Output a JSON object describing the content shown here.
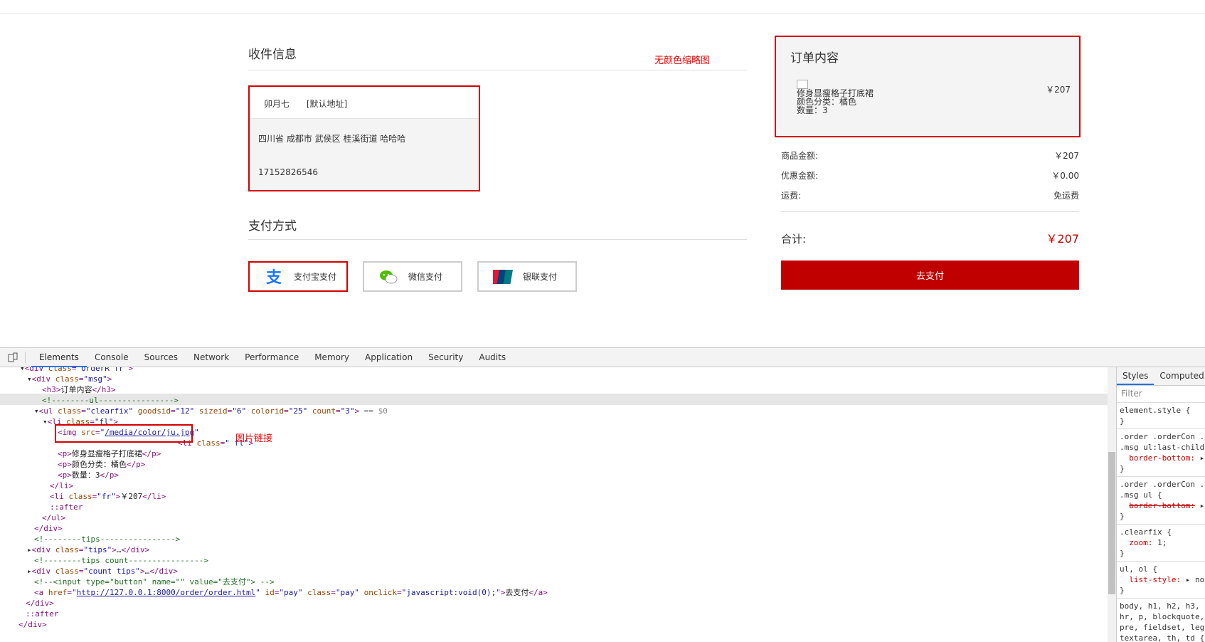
{
  "page": {
    "address_title": "收件信息",
    "annotation_thumbnail": "无颜色缩略图",
    "address": {
      "name": "卯月七",
      "default_tag": "[默认地址]",
      "detail": "四川省 成都市 武侯区 桂溪街道 哈哈哈",
      "phone": "17152826546"
    },
    "payment_title": "支付方式",
    "payment_methods": [
      {
        "label": "支付宝支付",
        "icon": "alipay-icon"
      },
      {
        "label": "微信支付",
        "icon": "wechat-icon"
      },
      {
        "label": "银联支付",
        "icon": "unionpay-icon"
      }
    ],
    "order": {
      "title": "订单内容",
      "item_name": "修身显瘦格子打底裙",
      "item_color": "颜色分类：橘色",
      "item_qty": "数量：3",
      "item_price": "￥207"
    },
    "summary": {
      "goods_label": "商品金额:",
      "goods_value": "￥207",
      "discount_label": "优惠金额:",
      "discount_value": "￥0.00",
      "shipping_label": "运费:",
      "shipping_value": "免运费",
      "total_label": "合计:",
      "total_value": "￥207"
    },
    "pay_button": "去支付"
  },
  "devtools": {
    "tabs": [
      "Elements",
      "Console",
      "Sources",
      "Network",
      "Performance",
      "Memory",
      "Application",
      "Security",
      "Audits"
    ],
    "annotation_img_link": "图片链接",
    "styles_tabs": [
      "Styles",
      "Computed"
    ],
    "filter_placeholder": "Filter"
  },
  "colors": {
    "accent": "#c00000",
    "annotation": "#d40000"
  }
}
